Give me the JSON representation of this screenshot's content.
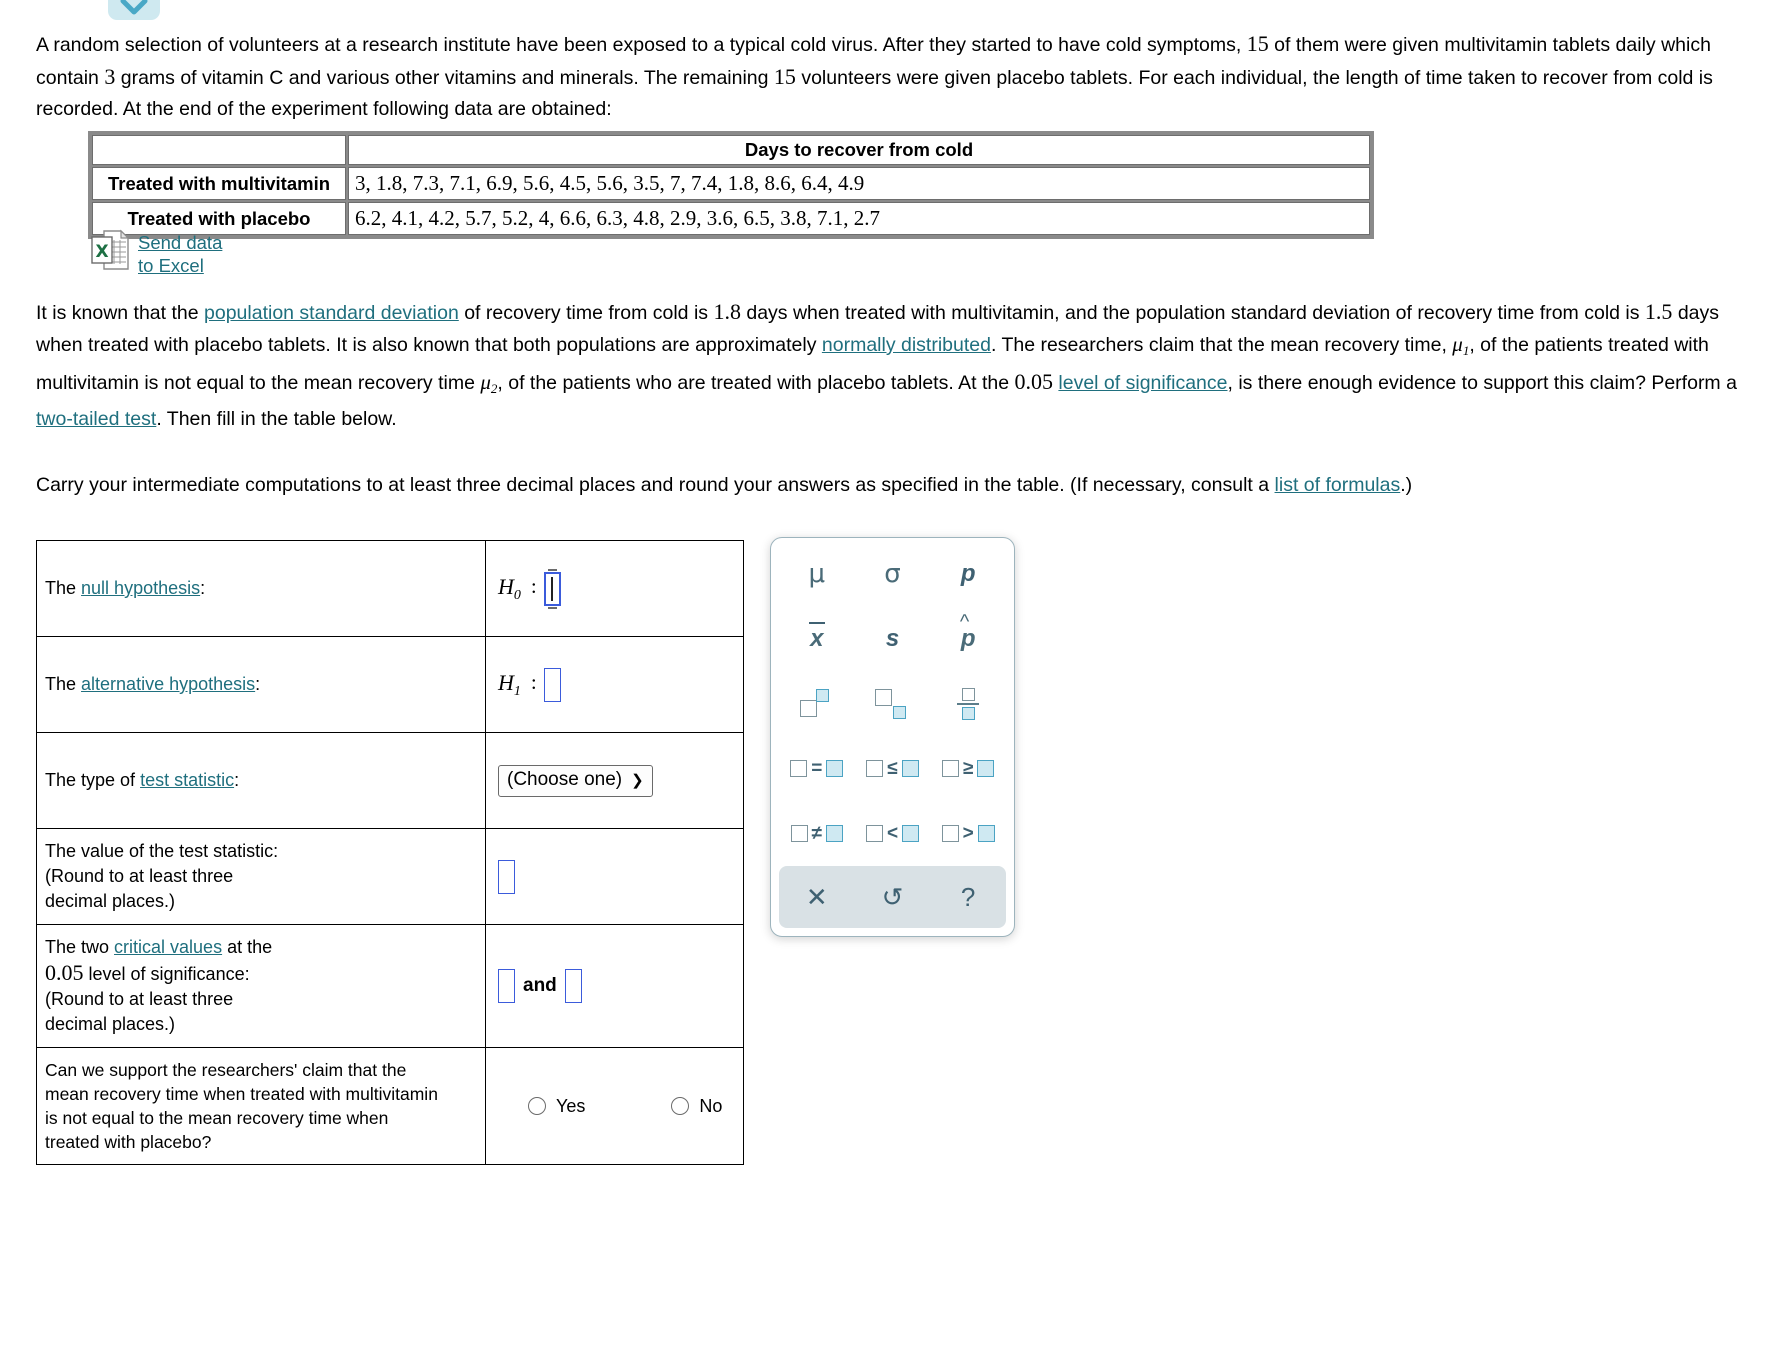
{
  "top_chip": {
    "icon": "chevron-down-icon"
  },
  "intro": {
    "part1": "A random selection of volunteers at a research institute have been exposed to a typical cold virus. After they started to have cold symptoms, ",
    "n1": "15",
    "part2": " of them were given multivitamin tablets daily which contain ",
    "grams": "3",
    "part3": " grams of vitamin C and various other vitamins and minerals. The remaining ",
    "n2": "15",
    "part4": " volunteers were given placebo tablets. For each individual, the length of time taken to recover from cold is recorded. At the end of the experiment following data are obtained:"
  },
  "data_table": {
    "header_blank": "",
    "header_title": "Days to recover from cold",
    "rows": [
      {
        "label": "Treated with multivitamin",
        "values": "3, 1.8, 7.3, 7.1, 6.9, 5.6, 4.5, 5.6, 3.5, 7, 7.4, 1.8, 8.6, 6.4, 4.9"
      },
      {
        "label": "Treated with placebo",
        "values": "6.2, 4.1, 4.2, 5.7, 5.2, 4, 6.6, 6.3, 4.8, 2.9, 3.6, 6.5, 3.8, 7.1, 2.7"
      }
    ]
  },
  "excel": {
    "icon": "excel-file-icon",
    "line1": "Send data",
    "line2": "to Excel"
  },
  "body": {
    "p2_a": "It is known that the ",
    "p2_link1": "population standard deviation",
    "p2_b": " of recovery time from cold is ",
    "sd1": "1.8",
    "p2_c": " days when treated with multivitamin, and the population standard deviation of recovery time from cold is ",
    "sd2": "1.5",
    "p2_d": " days when treated with placebo tablets. It is also known that both populations are approximately ",
    "p2_link2": "normally distributed",
    "p2_e": ". The researchers claim that the mean recovery time, ",
    "mu1": "μ",
    "mu1_sub": "1",
    "p2_f": ", of the patients treated with multivitamin is not equal to the mean recovery time ",
    "mu2": "μ",
    "mu2_sub": "2",
    "p2_g": ", of the patients who are treated with placebo tablets. At the ",
    "alpha": "0.05",
    "p2_link3": "level of significance",
    "p2_h": ", is there enough evidence to support this claim? Perform a ",
    "p2_link4": "two-tailed test",
    "p2_i": ". Then fill in the table below.",
    "p3_a": "Carry your intermediate computations to at least three decimal places and round your answers as specified in the table. (If necessary, consult a ",
    "p3_link": "list of formulas",
    "p3_b": ".)"
  },
  "answer_table": {
    "rows": {
      "null": {
        "label_a": "The ",
        "label_link": "null hypothesis",
        "label_b": ":",
        "sym": "H",
        "sym_sub": "0",
        "colon": ":",
        "input_value": "",
        "focused": true
      },
      "alt": {
        "label_a": "The ",
        "label_link": "alternative hypothesis",
        "label_b": ":",
        "sym": "H",
        "sym_sub": "1",
        "colon": ":",
        "input_value": ""
      },
      "teststat_type": {
        "label_a": "The type of ",
        "label_link": "test statistic",
        "label_b": ":",
        "select_value": "(Choose one)",
        "select_caret": "⌄"
      },
      "teststat_value": {
        "label_line1": "The value of the test statistic:",
        "label_line2": "(Round to at least three",
        "label_line3": "decimal places.)",
        "input_value": ""
      },
      "critical": {
        "label_a": "The two ",
        "label_link": "critical values",
        "label_b": " at the",
        "label_alpha": "0.05",
        "label_c": " level of significance:",
        "label_line3": "(Round to at least three",
        "label_line4": "decimal places.)",
        "input1_value": "",
        "and_text": "and",
        "input2_value": ""
      },
      "conclusion": {
        "question_line1": "Can we support the researchers' claim that the",
        "question_line2": "mean recovery time when treated with multivitamin",
        "question_line3": "is not equal to the mean recovery time when",
        "question_line4": "treated with placebo?",
        "options": [
          {
            "label": "Yes",
            "selected": false
          },
          {
            "label": "No",
            "selected": false
          }
        ]
      }
    }
  },
  "palette": {
    "cells": [
      {
        "name": "mu-symbol",
        "text": "μ"
      },
      {
        "name": "sigma-symbol",
        "text": "σ"
      },
      {
        "name": "p-symbol",
        "text": "p"
      },
      {
        "name": "x-bar-symbol",
        "text": "x"
      },
      {
        "name": "s-symbol",
        "text": "s"
      },
      {
        "name": "p-hat-symbol",
        "text": "p"
      },
      {
        "name": "superscript-template",
        "text": ""
      },
      {
        "name": "subscript-template",
        "text": ""
      },
      {
        "name": "fraction-template",
        "text": ""
      },
      {
        "name": "equals-template",
        "text": "="
      },
      {
        "name": "less-equal-template",
        "text": "≤"
      },
      {
        "name": "greater-equal-template",
        "text": "≥"
      },
      {
        "name": "not-equal-template",
        "text": "≠"
      },
      {
        "name": "less-than-template",
        "text": "<"
      },
      {
        "name": "greater-than-template",
        "text": ">"
      }
    ],
    "buttons": [
      {
        "name": "clear-button",
        "glyph": "✕"
      },
      {
        "name": "undo-button",
        "glyph": "↺"
      },
      {
        "name": "help-button",
        "glyph": "?"
      }
    ]
  },
  "colors": {
    "link": "#1f6f7e",
    "input_border": "#3b5bdb",
    "palette_accent": "#4ba3c3",
    "palette_text": "#3f6172",
    "chip_bg": "#cfe9f0"
  }
}
